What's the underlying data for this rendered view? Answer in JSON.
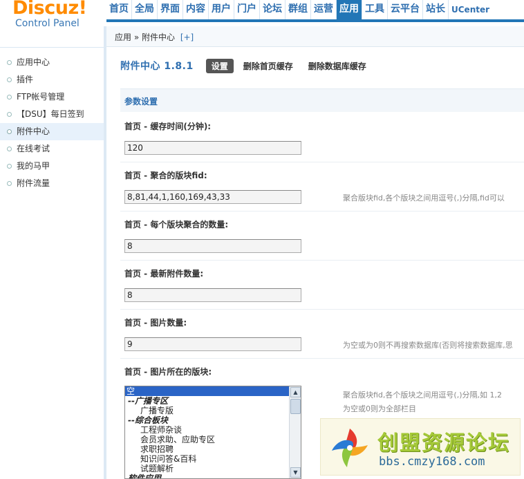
{
  "logo": {
    "brand": "Discuz!",
    "sub": "Control Panel"
  },
  "topnav": [
    {
      "label": "首页",
      "name": "nav-home",
      "active": false
    },
    {
      "label": "全局",
      "name": "nav-global",
      "active": false
    },
    {
      "label": "界面",
      "name": "nav-style",
      "active": false
    },
    {
      "label": "内容",
      "name": "nav-content",
      "active": false
    },
    {
      "label": "用户",
      "name": "nav-user",
      "active": false
    },
    {
      "label": "门户",
      "name": "nav-portal",
      "active": false
    },
    {
      "label": "论坛",
      "name": "nav-forum",
      "active": false
    },
    {
      "label": "群组",
      "name": "nav-group",
      "active": false
    },
    {
      "label": "运营",
      "name": "nav-extended",
      "active": false
    },
    {
      "label": "应用",
      "name": "nav-plugin",
      "active": true
    },
    {
      "label": "工具",
      "name": "nav-tools",
      "active": false
    },
    {
      "label": "云平台",
      "name": "nav-cloud",
      "active": false
    },
    {
      "label": "站长",
      "name": "nav-founder",
      "active": false
    },
    {
      "label": "UCenter",
      "name": "nav-ucenter",
      "active": false
    }
  ],
  "breadcrumb": {
    "path": "应用 » 附件中心",
    "add": "[+]"
  },
  "sidebar": {
    "items": [
      {
        "label": "应用中心",
        "active": false
      },
      {
        "label": "插件",
        "active": false
      },
      {
        "label": "FTP帐号管理",
        "active": false
      },
      {
        "label": "【DSU】每日签到",
        "active": false
      },
      {
        "label": "附件中心",
        "active": true
      },
      {
        "label": "在线考试",
        "active": false
      },
      {
        "label": "我的马甲",
        "active": false
      },
      {
        "label": "附件流量",
        "active": false
      }
    ]
  },
  "main": {
    "title": "附件中心 1.8.1",
    "tabs": [
      {
        "label": "设置",
        "active": true
      },
      {
        "label": "删除首页缓存",
        "active": false
      },
      {
        "label": "删除数据库缓存",
        "active": false
      }
    ],
    "section_title": "参数设置",
    "fields": [
      {
        "label": "首页 - 缓存时间(分钟):",
        "value": "120",
        "hint": ""
      },
      {
        "label": "首页 - 聚合的版块fid:",
        "value": "8,81,44,1,160,169,43,33",
        "hint": "聚合版块fid,各个版块之间用逗号(,)分隔,fid可以"
      },
      {
        "label": "首页 - 每个版块聚合的数量:",
        "value": "8",
        "hint": ""
      },
      {
        "label": "首页 - 最新附件数量:",
        "value": "8",
        "hint": ""
      },
      {
        "label": "首页 - 图片数量:",
        "value": "9",
        "hint": "为空或为0则不再搜索数据库(否则将搜索数据库,思"
      }
    ],
    "listfield": {
      "label": "首页 - 图片所在的版块:",
      "hint1": "聚合版块fid,各个版块之间用逗号(,)分隔,如 1,2",
      "hint2": "为空或0则为全部栏目",
      "options": [
        {
          "text": "空",
          "type": "sel"
        },
        {
          "text": "--广播专区",
          "type": "grp"
        },
        {
          "text": "广播专版",
          "type": "child"
        },
        {
          "text": "--综合板块",
          "type": "grp"
        },
        {
          "text": "工程师杂谈",
          "type": "child"
        },
        {
          "text": "会员求助、应助专区",
          "type": "child"
        },
        {
          "text": "求职招聘",
          "type": "child"
        },
        {
          "text": "知识问答&百科",
          "type": "child"
        },
        {
          "text": "试题解析",
          "type": "child"
        },
        {
          "text": "软件应用",
          "type": "grp"
        }
      ]
    }
  },
  "watermark": {
    "title": "创盟资源论坛",
    "url": "bbs.cmzy168.com"
  },
  "colors": {
    "accent": "#2276b6",
    "brand": "#ff8b00",
    "link": "#2f6fb0",
    "watermark_green": "#a5c938"
  }
}
